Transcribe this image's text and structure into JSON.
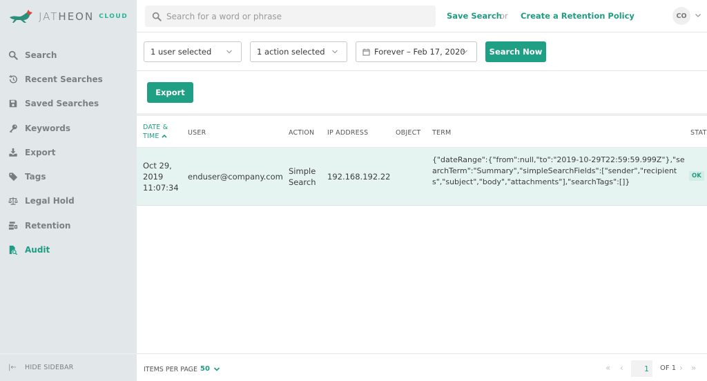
{
  "brand": {
    "name_light": "JAT",
    "name_bold": "HEON",
    "suffix": "CLOUD",
    "accent": "#1f9c82"
  },
  "sidebar": {
    "items": [
      {
        "label": "Search",
        "icon": "search-icon",
        "active": false
      },
      {
        "label": "Recent Searches",
        "icon": "history-icon",
        "active": false
      },
      {
        "label": "Saved Searches",
        "icon": "floppy-disk-icon",
        "active": false
      },
      {
        "label": "Keywords",
        "icon": "key-icon",
        "active": false
      },
      {
        "label": "Export",
        "icon": "download-icon",
        "active": false
      },
      {
        "label": "Tags",
        "icon": "tag-icon",
        "active": false
      },
      {
        "label": "Legal Hold",
        "icon": "scales-icon",
        "active": false
      },
      {
        "label": "Retention",
        "icon": "archive-icon",
        "active": false
      },
      {
        "label": "Audit",
        "icon": "audit-file-search-icon",
        "active": true
      }
    ],
    "hide_label": "HIDE SIDEBAR"
  },
  "header": {
    "search_placeholder": "Search for a word or phrase",
    "save_search": "Save Search",
    "or": "or",
    "create_policy": "Create a Retention Policy",
    "avatar_initials": "CO"
  },
  "filters": {
    "user": "1 user selected",
    "action": "1 action selected",
    "date_range": "Forever – Feb 17, 2020",
    "search_button": "Search Now"
  },
  "toolbar": {
    "export_label": "Export"
  },
  "table": {
    "columns": {
      "datetime_line1": "DATE &",
      "datetime_line2": "TIME",
      "user": "USER",
      "action": "ACTION",
      "ip": "IP ADDRESS",
      "object": "OBJECT",
      "term": "TERM",
      "status": "STATUS"
    },
    "rows": [
      {
        "date_line1": "Oct 29,",
        "date_line2": "2019",
        "date_line3": "11:07:34",
        "user": "enduser@company.com",
        "action_line1": "Simple",
        "action_line2": "Search",
        "ip": "192.168.192.22",
        "object": "",
        "term": "{\"dateRange\":{\"from\":null,\"to\":\"2019-10-29T22:59:59.999Z\"},\"searchTerm\":\"Summary\",\"simpleSearchFields\":[\"sender\",\"recipients\",\"subject\",\"body\",\"attachments\"],\"searchTags\":[]}",
        "status": "OK"
      }
    ]
  },
  "footer": {
    "items_per_page_label": "ITEMS PER PAGE",
    "items_per_page_value": "50",
    "current_page": "1",
    "of_label": "OF 1"
  }
}
